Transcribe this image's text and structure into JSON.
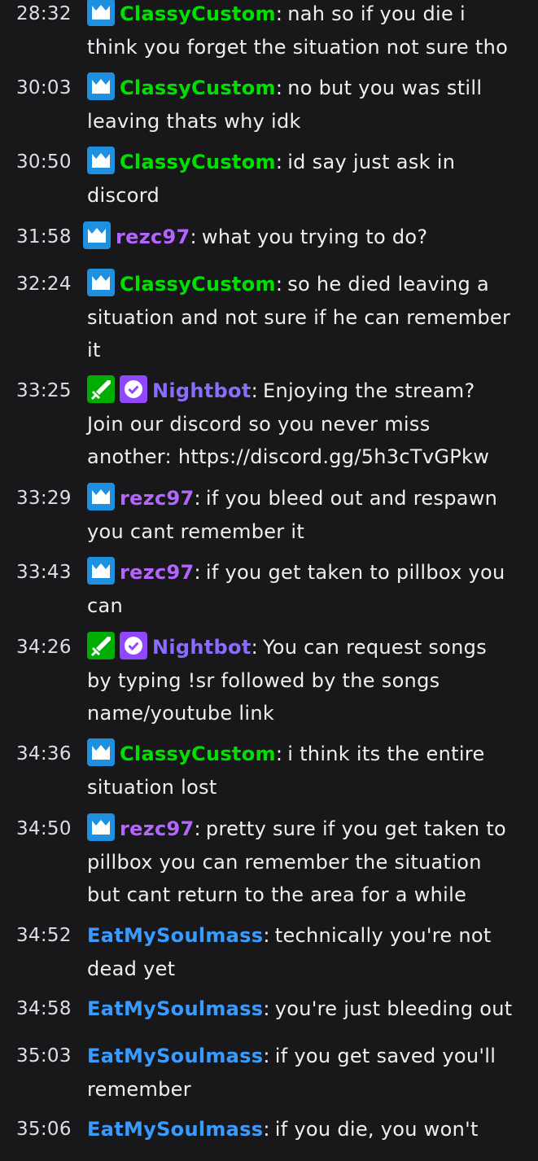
{
  "colors": {
    "background": "#18181b",
    "ClassyCustom": "#00e000",
    "rezc97": "#b565ff",
    "Nightbot": "#8b6cff",
    "EatMySoulmass": "#3a9bff"
  },
  "messages": [
    {
      "time": "28:32",
      "badges": [
        "crown-icon"
      ],
      "user": "ClassyCustom",
      "color": "#00e000",
      "text": "nah so if you die i think you forget the situation not sure tho"
    },
    {
      "time": "30:03",
      "badges": [
        "crown-icon"
      ],
      "user": "ClassyCustom",
      "color": "#00e000",
      "text": "no but you was still leaving thats why idk"
    },
    {
      "time": "30:50",
      "badges": [
        "crown-icon"
      ],
      "user": "ClassyCustom",
      "color": "#00e000",
      "text": "id say just ask in discord"
    },
    {
      "time": "31:58",
      "badges": [
        "crown-icon"
      ],
      "user": "rezc97",
      "color": "#b565ff",
      "text": "what you trying to do?"
    },
    {
      "time": "32:24",
      "badges": [
        "crown-icon"
      ],
      "user": "ClassyCustom",
      "color": "#00e000",
      "text": "so he died leaving a situation and not sure if he can remember it"
    },
    {
      "time": "33:25",
      "badges": [
        "sword-icon",
        "verified-icon"
      ],
      "user": "Nightbot",
      "color": "#8b6cff",
      "text": "Enjoying the stream? Join our discord so you never miss another: https://discord.gg/5h3cTvGPkw"
    },
    {
      "time": "33:29",
      "badges": [
        "crown-icon"
      ],
      "user": "rezc97",
      "color": "#b565ff",
      "text": "if you bleed out and respawn you cant remember it"
    },
    {
      "time": "33:43",
      "badges": [
        "crown-icon"
      ],
      "user": "rezc97",
      "color": "#b565ff",
      "text": "if you get taken to pillbox you can"
    },
    {
      "time": "34:26",
      "badges": [
        "sword-icon",
        "verified-icon"
      ],
      "user": "Nightbot",
      "color": "#8b6cff",
      "text": "You can request songs by typing !sr followed by the songs name/youtube link"
    },
    {
      "time": "34:36",
      "badges": [
        "crown-icon"
      ],
      "user": "ClassyCustom",
      "color": "#00e000",
      "text": "i think its the entire situation lost"
    },
    {
      "time": "34:50",
      "badges": [
        "crown-icon"
      ],
      "user": "rezc97",
      "color": "#b565ff",
      "text": "pretty sure if you get taken to pillbox you can remember the situation but cant return to the area for a while"
    },
    {
      "time": "34:52",
      "badges": [],
      "user": "EatMySoulmass",
      "color": "#3a9bff",
      "text": "technically you're not dead yet"
    },
    {
      "time": "34:58",
      "badges": [],
      "user": "EatMySoulmass",
      "color": "#3a9bff",
      "text": "you're just bleeding out"
    },
    {
      "time": "35:03",
      "badges": [],
      "user": "EatMySoulmass",
      "color": "#3a9bff",
      "text": "if you get saved you'll remember"
    },
    {
      "time": "35:06",
      "badges": [],
      "user": "EatMySoulmass",
      "color": "#3a9bff",
      "text": "if you die, you won't"
    }
  ]
}
